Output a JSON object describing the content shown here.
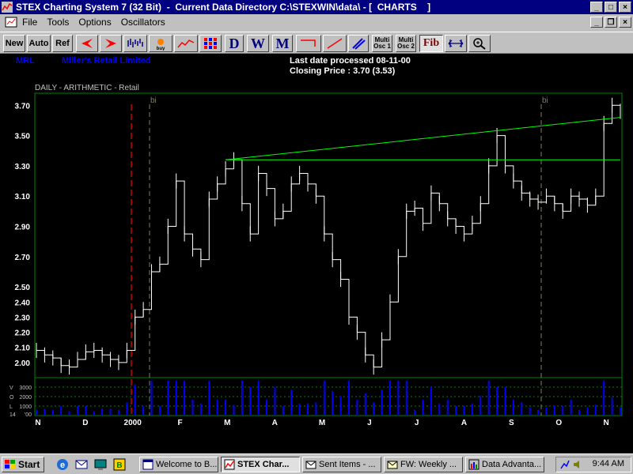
{
  "window": {
    "title": "STEX Charting System 7 (32 Bit)  -  Current Data Directory C:\\STEXWIN\\data\\ - [  CHARTS    ]"
  },
  "menu": {
    "items": [
      "File",
      "Tools",
      "Options",
      "Oscillators"
    ]
  },
  "toolbar": {
    "new": "New",
    "auto": "Auto",
    "ref": "Ref",
    "daily": "D",
    "weekly": "W",
    "monthly": "M",
    "multi_osc1": "Multi Osc 1",
    "multi_osc2": "Multi Osc 2",
    "fib": "Fib",
    "buy_label": "buy"
  },
  "chart_header": {
    "symbol": "MRL",
    "company": "Miller's Retail Limited",
    "last_date": "Last date processed 08-11-00",
    "closing_price": "Closing Price : 3.70  (3.53)",
    "mode": "DAILY - ARITHMETIC -      Retail",
    "marker_label": "bi"
  },
  "colors": {
    "background": "#000000",
    "price": "#ffffff",
    "volume": "#0000ff",
    "trendline": "#00ff00",
    "red_marker": "#ff0000",
    "grid": "#008000",
    "header_text": "#0000ff"
  },
  "chart_data": {
    "type": "line",
    "xlabel": "",
    "ylabel": "",
    "ylim": [
      1.9,
      3.78
    ],
    "y_ticks": [
      "3.70",
      "3.50",
      "3.30",
      "3.10",
      "2.90",
      "2.70",
      "2.50",
      "2.40",
      "2.30",
      "2.20",
      "2.10",
      "2.00"
    ],
    "volume_ticks": [
      "3000",
      "2000",
      "1000",
      "'00"
    ],
    "volume_axis_letters": [
      "V",
      "O",
      "L",
      "14"
    ],
    "x_labels": [
      "N",
      "D",
      "2000",
      "F",
      "M",
      "A",
      "M",
      "J",
      "J",
      "A",
      "S",
      "O",
      "N"
    ],
    "series": [
      {
        "x": [
          "N",
          "N",
          "N",
          "N",
          "N",
          "N",
          "D",
          "D",
          "D",
          "D",
          "D",
          "D",
          "D",
          "D",
          "2000",
          "2000",
          "2000",
          "2000",
          "2000",
          "F",
          "F",
          "F",
          "F",
          "F",
          "F",
          "M",
          "M",
          "M",
          "M",
          "M",
          "M",
          "A",
          "A",
          "A",
          "A",
          "A",
          "M",
          "M",
          "M",
          "M",
          "M",
          "M",
          "J",
          "J",
          "J",
          "J",
          "J",
          "J",
          "J",
          "J",
          "J",
          "A",
          "A",
          "A",
          "A",
          "A",
          "A",
          "S",
          "S",
          "S",
          "S",
          "S",
          "S",
          "O",
          "O",
          "O",
          "O",
          "O",
          "O",
          "N",
          "N",
          "N"
        ],
        "y": [
          2.08,
          2.05,
          2.03,
          1.98,
          1.97,
          2.02,
          2.07,
          2.08,
          2.05,
          2.02,
          2.0,
          2.08,
          2.3,
          2.35,
          2.6,
          2.65,
          2.9,
          3.2,
          2.85,
          2.75,
          2.68,
          3.08,
          3.18,
          3.28,
          3.34,
          3.05,
          2.85,
          3.25,
          3.15,
          2.95,
          3.0,
          3.18,
          3.25,
          3.18,
          3.1,
          2.85,
          2.68,
          2.55,
          2.3,
          2.2,
          2.05,
          1.97,
          2.15,
          2.4,
          2.7,
          3.0,
          3.02,
          2.92,
          3.12,
          3.05,
          2.95,
          2.9,
          2.85,
          2.92,
          3.05,
          3.3,
          3.5,
          3.3,
          3.2,
          3.12,
          3.08,
          3.06,
          3.1,
          3.05,
          3.0,
          3.1,
          3.08,
          3.04,
          3.1,
          3.58,
          3.7,
          3.66
        ]
      }
    ],
    "trendlines": [
      {
        "from": {
          "x": "F",
          "y": 3.34
        },
        "to": {
          "x": "N",
          "y": 3.62
        }
      },
      {
        "from": {
          "x": "F",
          "y": 3.34
        },
        "to": {
          "x": "N",
          "y": 3.34
        }
      }
    ]
  },
  "taskbar": {
    "start": "Start",
    "tasks": [
      "Welcome to B...",
      "STEX Char...",
      "Sent Items - ...",
      "FW: Weekly ...",
      "Data Advanta..."
    ],
    "clock": "9:44 AM"
  }
}
